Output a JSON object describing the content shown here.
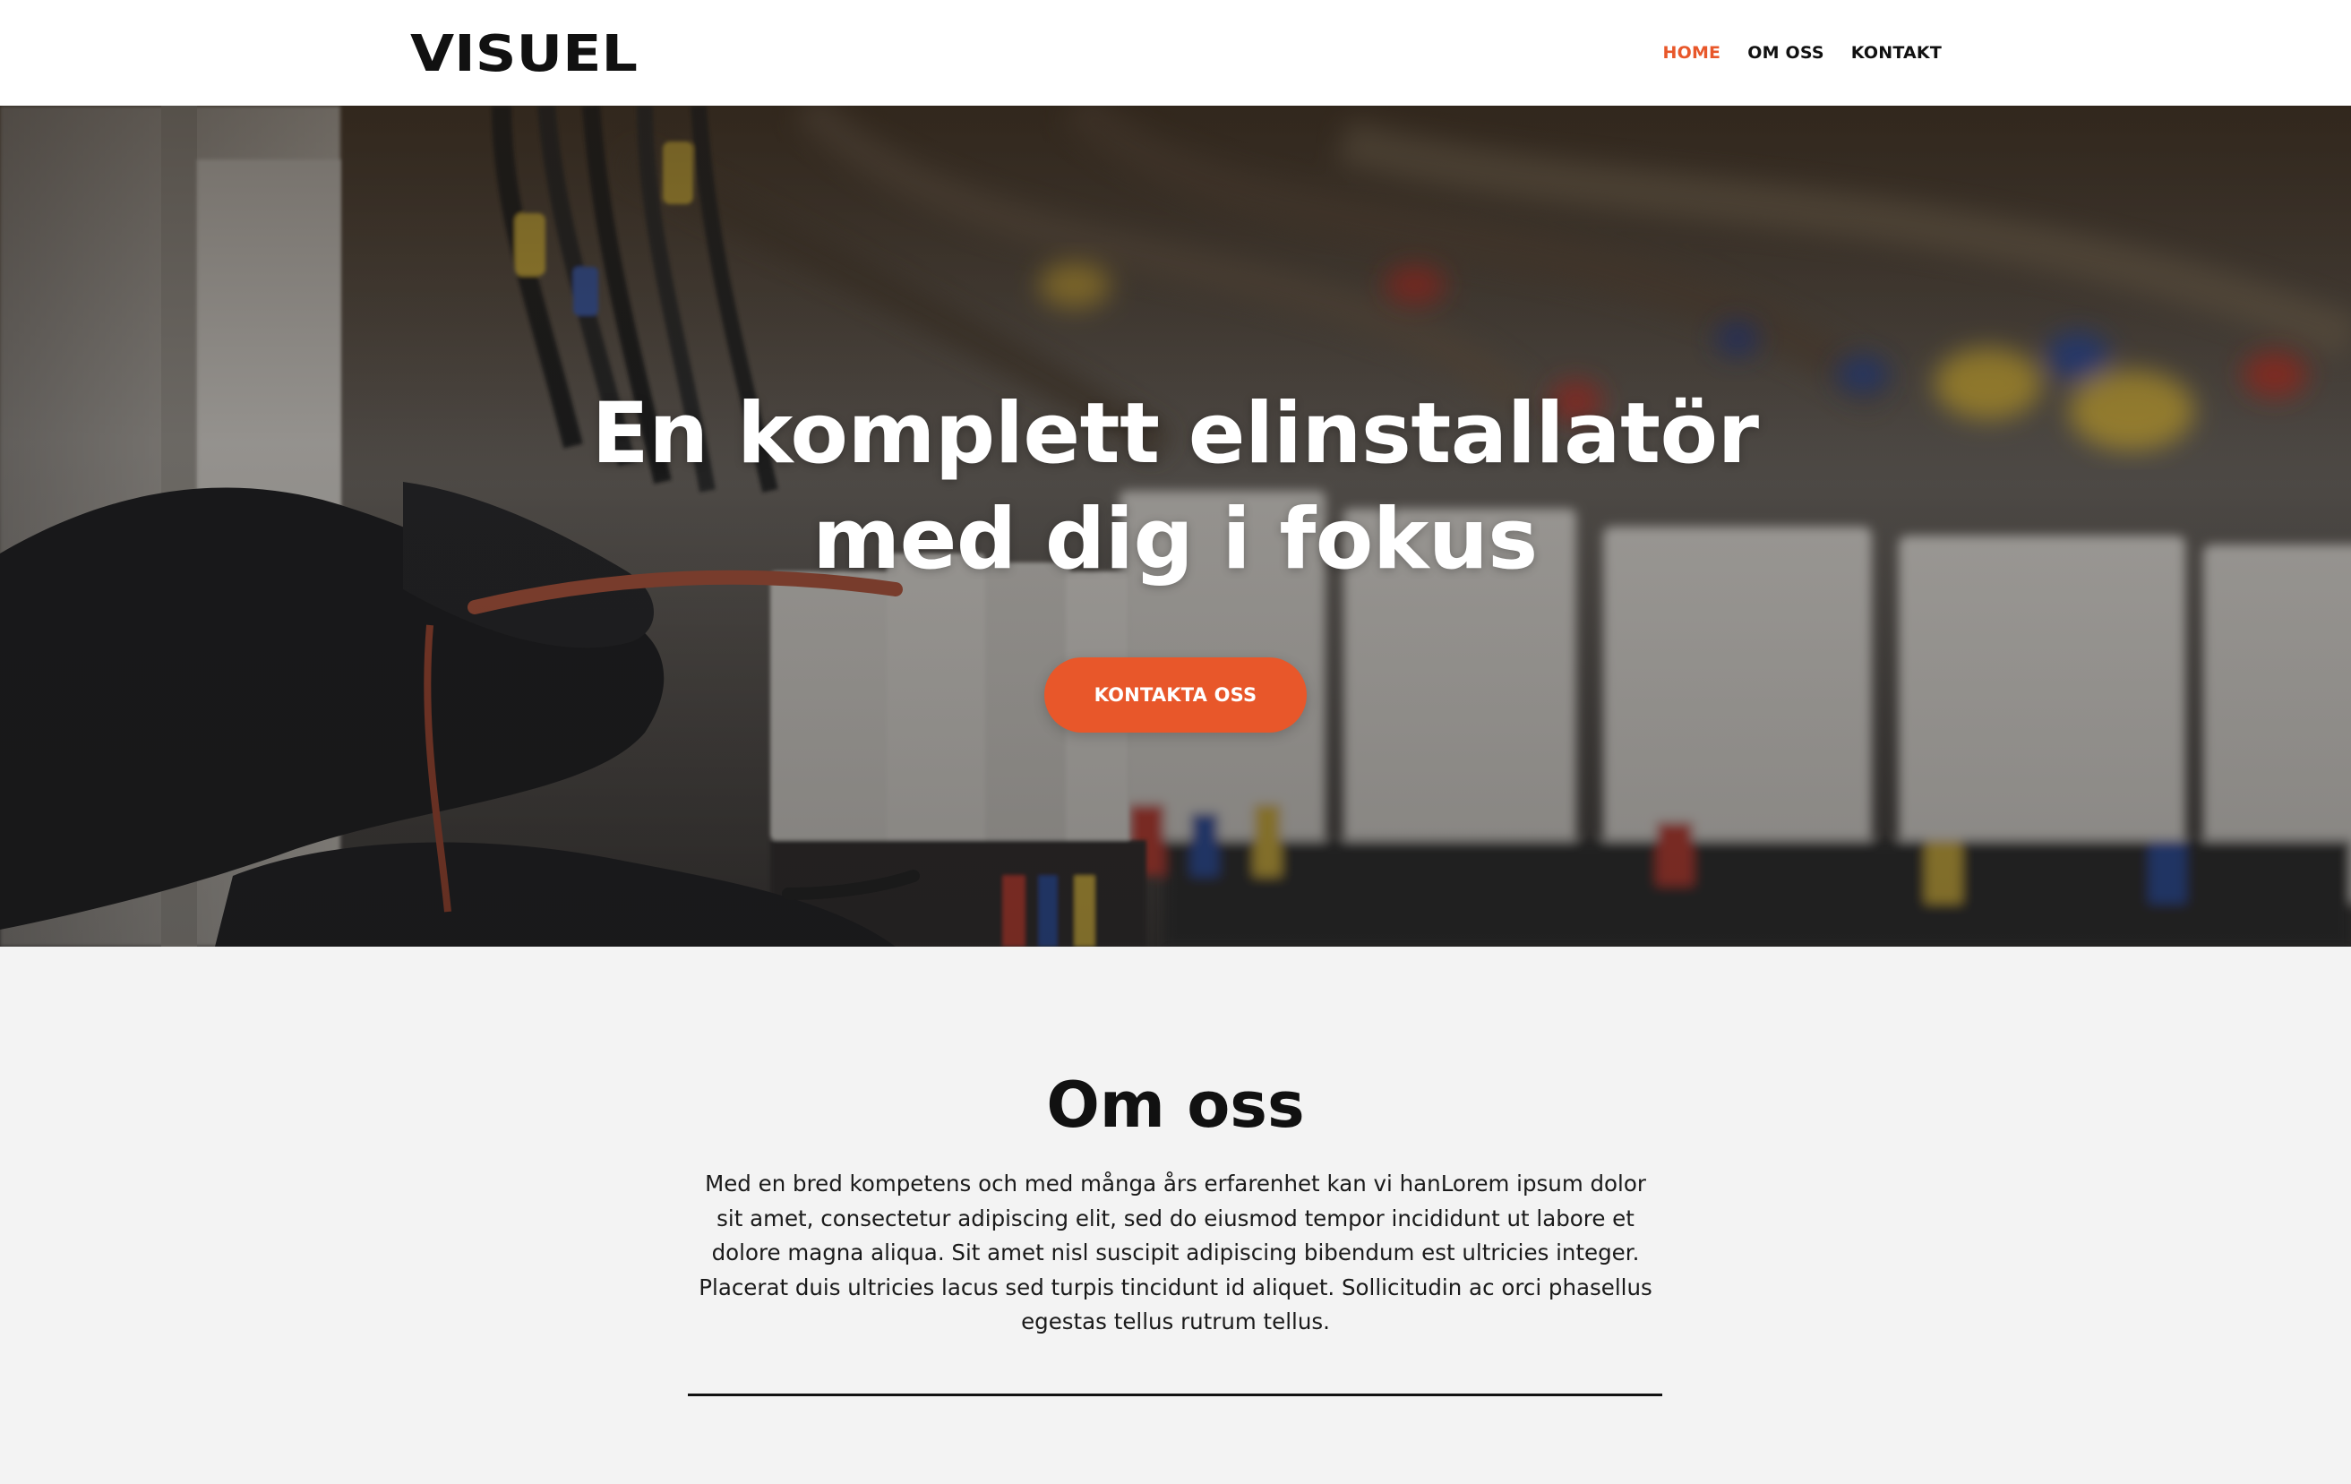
{
  "header": {
    "logo_text": "VISUEL",
    "nav": [
      {
        "label": "HOME",
        "active": true
      },
      {
        "label": "OM OSS",
        "active": false
      },
      {
        "label": "KONTAKT",
        "active": false
      }
    ]
  },
  "hero": {
    "title_line1": "En komplett elinstallatör",
    "title_line2": "med dig i fokus",
    "cta_label": "KONTAKTA OSS"
  },
  "about": {
    "title": "Om oss",
    "text": "Med en bred kompetens och med många års erfarenhet kan vi hanLorem ipsum dolor sit amet, consectetur adipiscing elit, sed do eiusmod tempor incididunt ut labore et dolore magna aliqua. Sit amet nisl suscipit adipiscing bibendum est ultricies integer. Placerat duis ultricies lacus sed turpis tincidunt id aliquet. Sollicitudin ac orci phasellus egestas tellus rutrum tellus."
  },
  "colors": {
    "accent": "#e8572a",
    "text": "#111111",
    "section_bg": "#f3f3f3",
    "header_bg": "#ffffff"
  }
}
